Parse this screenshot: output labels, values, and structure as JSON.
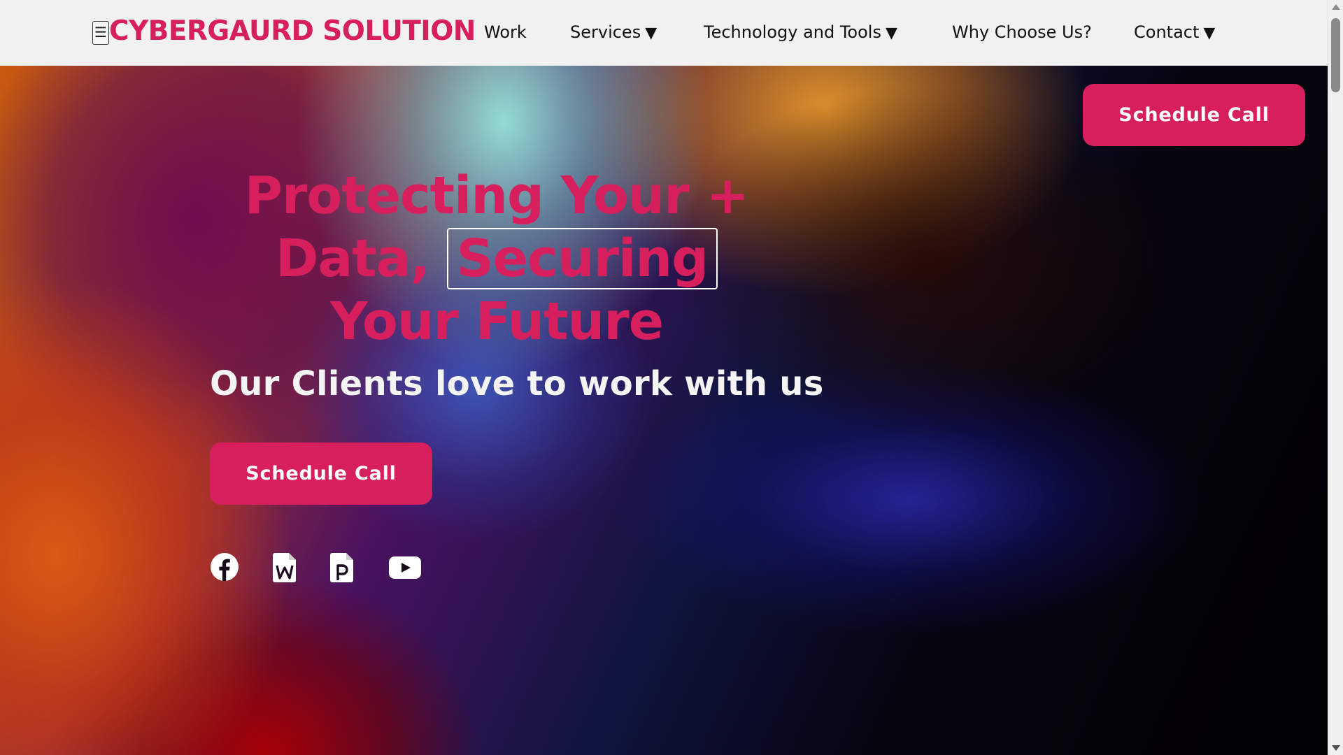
{
  "navbar": {
    "menu_toggle_glyph": "☰",
    "brand": "CYBERGAURD SOLUTION",
    "links": [
      {
        "label": "Work",
        "dropdown": false
      },
      {
        "label": "Services",
        "dropdown": true
      },
      {
        "label": "Technology and Tools",
        "dropdown": true
      },
      {
        "label": "Why Choose Us?",
        "dropdown": false
      },
      {
        "label": "Contact",
        "dropdown": true
      }
    ],
    "caret_glyph": "▼"
  },
  "hero": {
    "schedule_top_label": "Schedule Call",
    "headline_line1": "Protecting Your +",
    "headline_line2_prefix": "Data,",
    "headline_line2_highlight": "Securing",
    "headline_line3": "Your Future",
    "subheadline": "Our Clients love to work with us",
    "schedule_label": "Schedule Call",
    "social_icons": [
      "facebook-icon",
      "word-doc-icon",
      "pdf-doc-icon",
      "youtube-icon"
    ]
  },
  "colors": {
    "accent": "#d81f5e",
    "navbar_bg": "#f1f1f1",
    "text_dark": "#111111",
    "text_light": "#f4f4f4"
  }
}
